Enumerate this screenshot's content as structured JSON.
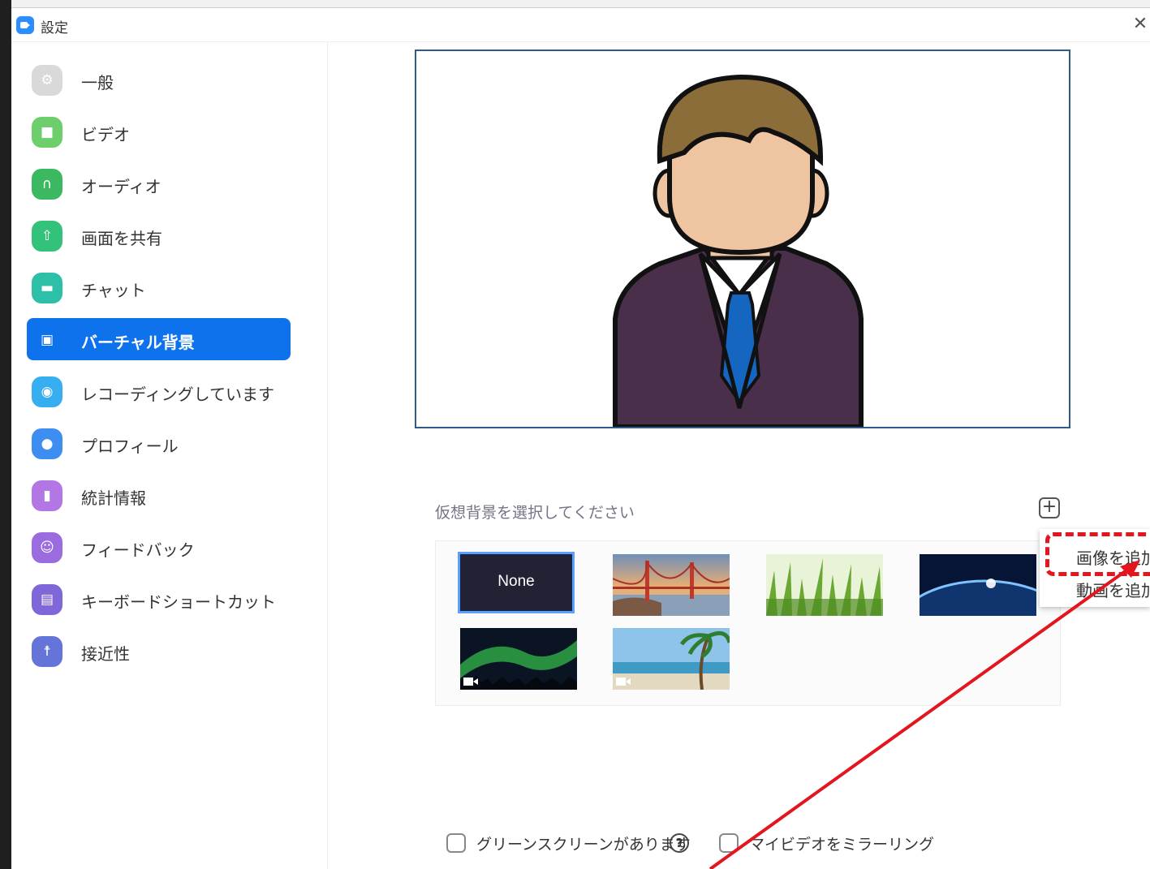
{
  "window": {
    "title": "設定"
  },
  "sidebar": {
    "items": [
      {
        "label": "一般",
        "icon": "gear-icon",
        "color": "#d7d7d7"
      },
      {
        "label": "ビデオ",
        "icon": "video-camera-icon",
        "color": "#6ccf6c"
      },
      {
        "label": "オーディオ",
        "icon": "headphones-icon",
        "color": "#3cb860"
      },
      {
        "label": "画面を共有",
        "icon": "share-screen-icon",
        "color": "#33c27a"
      },
      {
        "label": "チャット",
        "icon": "chat-bubble-icon",
        "color": "#2dbfa8"
      },
      {
        "label": "バーチャル背景",
        "icon": "person-card-icon",
        "color": "#0e72ed"
      },
      {
        "label": "レコーディングしています",
        "icon": "record-icon",
        "color": "#37aef0"
      },
      {
        "label": "プロフィール",
        "icon": "user-icon",
        "color": "#3d8ef0"
      },
      {
        "label": "統計情報",
        "icon": "bar-chart-icon",
        "color": "#b277e4"
      },
      {
        "label": "フィードバック",
        "icon": "smiley-icon",
        "color": "#9a6ce0"
      },
      {
        "label": "キーボードショートカット",
        "icon": "keyboard-icon",
        "color": "#8067d9"
      },
      {
        "label": "接近性",
        "icon": "accessibility-icon",
        "color": "#6474d8"
      }
    ],
    "active_index": 5
  },
  "main": {
    "choose_label": "仮想背景を選択してください",
    "backgrounds": {
      "none_label": "None",
      "items": [
        "None",
        "golden-gate-bridge",
        "green-grass",
        "earth-from-space",
        "aurora-video",
        "beach-palm-video"
      ]
    },
    "add_menu": {
      "add_image": "画像を追加",
      "add_video": "動画を追加"
    },
    "options": {
      "green_screen": "グリーンスクリーンがあります",
      "mirror_video": "マイビデオをミラーリング"
    }
  },
  "colors": {
    "accent": "#0e72ed",
    "annotation_red": "#e3151f",
    "preview_border": "#2f5b8a"
  }
}
